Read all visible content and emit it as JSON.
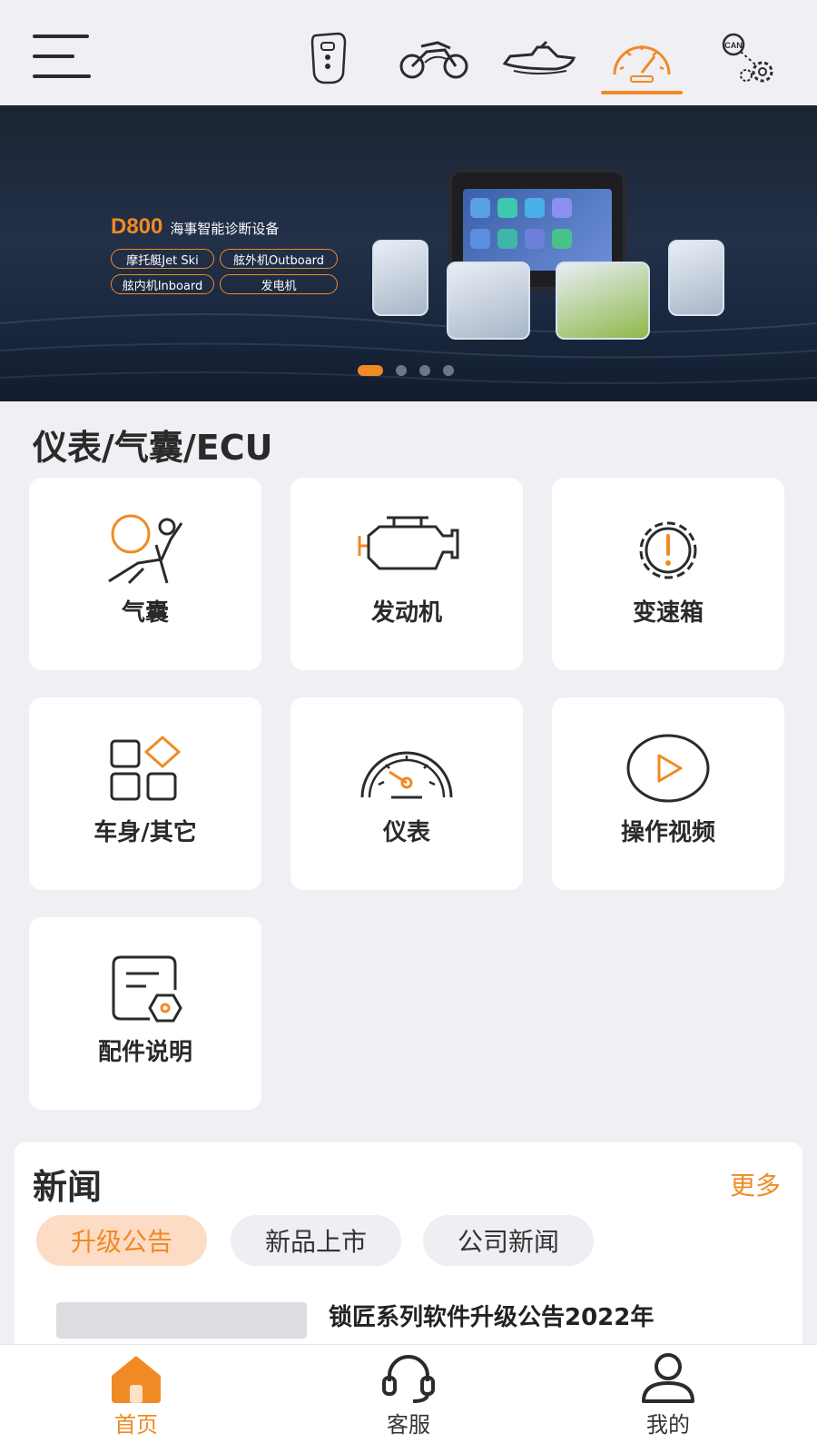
{
  "topbar": {
    "menu_icon": "hamburger-menu-icon",
    "categories": [
      {
        "icon": "car-key-icon"
      },
      {
        "icon": "motorcycle-icon"
      },
      {
        "icon": "jet-ski-icon"
      },
      {
        "icon": "dashboard-gauge-icon",
        "active": true
      },
      {
        "icon": "can-bus-gear-icon"
      }
    ]
  },
  "banner": {
    "model": "D800",
    "subtitle": "海事智能诊断设备",
    "tags": [
      "摩托艇Jet Ski",
      "舷外机Outboard",
      "舷内机Inboard",
      "发电机"
    ],
    "slide_count": 4,
    "active_slide": 1
  },
  "section": {
    "title": "仪表/气囊/ECU",
    "items": [
      {
        "label": "气囊",
        "icon": "airbag-icon"
      },
      {
        "label": "发动机",
        "icon": "engine-icon"
      },
      {
        "label": "变速箱",
        "icon": "transmission-warning-icon"
      },
      {
        "label": "车身/其它",
        "icon": "body-other-grid-icon"
      },
      {
        "label": "仪表",
        "icon": "gauge-icon"
      },
      {
        "label": "操作视频",
        "icon": "play-video-icon"
      },
      {
        "label": "配件说明",
        "icon": "accessory-doc-icon"
      }
    ]
  },
  "news": {
    "title": "新闻",
    "more": "更多",
    "tabs": [
      {
        "label": "升级公告",
        "active": true
      },
      {
        "label": "新品上市"
      },
      {
        "label": "公司新闻"
      }
    ],
    "first_headline": "锁匠系列软件升级公告2022年"
  },
  "bottom_nav": [
    {
      "label": "首页",
      "icon": "home-icon",
      "active": true
    },
    {
      "label": "客服",
      "icon": "headset-icon"
    },
    {
      "label": "我的",
      "icon": "user-icon"
    }
  ],
  "colors": {
    "accent": "#f08a24",
    "background": "#f0eff4",
    "card": "#ffffff"
  }
}
